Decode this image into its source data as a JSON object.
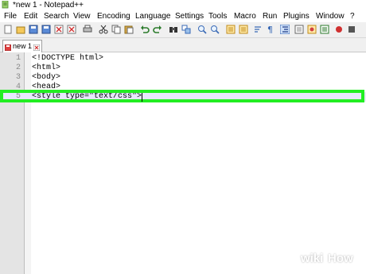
{
  "window": {
    "title": "*new 1 - Notepad++"
  },
  "menu": [
    "File",
    "Edit",
    "Search",
    "View",
    "Encoding",
    "Language",
    "Settings",
    "Tools",
    "Macro",
    "Run",
    "Plugins",
    "Window",
    "?"
  ],
  "tab": {
    "label": "new 1"
  },
  "editor": {
    "lines": [
      {
        "num": "1",
        "text": "<!DOCTYPE html>"
      },
      {
        "num": "2",
        "text": "<html>"
      },
      {
        "num": "3",
        "text": "<body>"
      },
      {
        "num": "4",
        "text": "<head>"
      },
      {
        "num": "5",
        "text": "<style type=\"text/css\">"
      }
    ],
    "current_line": 5
  },
  "watermark": {
    "wiki": "wiki",
    "how": "How"
  },
  "colors": {
    "highlight": "#22ee22",
    "current_line": "#e8e8ff"
  }
}
